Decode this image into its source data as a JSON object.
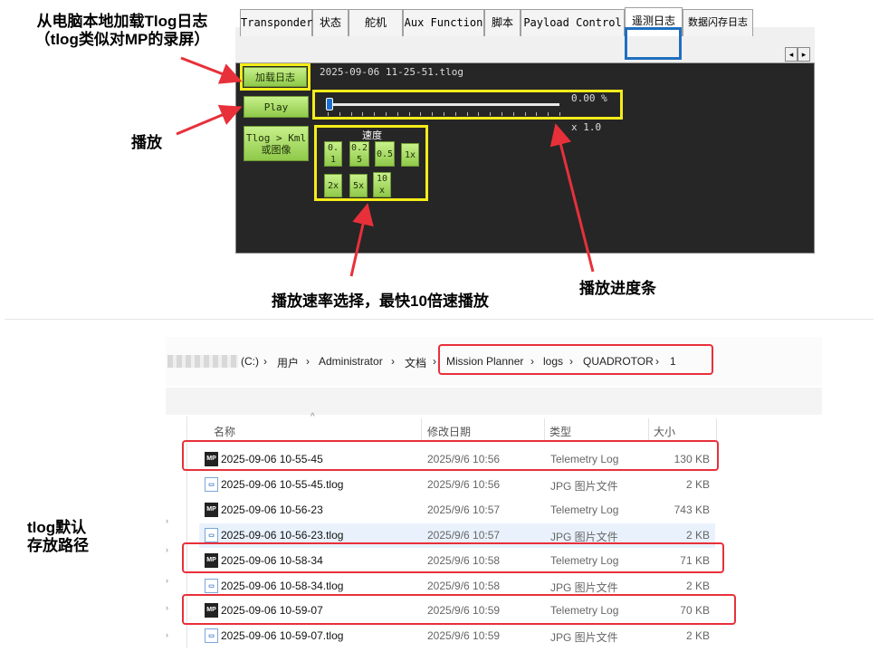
{
  "annotations": {
    "load_note_line1": "从电脑本地加载Tlog日志",
    "load_note_line2": "（tlog类似对MP的录屏）",
    "play_note": "播放",
    "speed_note": "播放速率选择，最快10倍速播放",
    "progress_note": "播放进度条",
    "path_note_line1": "tlog默认",
    "path_note_line2": "存放路径"
  },
  "tabs": [
    "Transponder",
    "状态",
    "舵机",
    "Aux Function",
    "脚本",
    "Payload Control",
    "遥测日志",
    "数据闪存日志"
  ],
  "tab_nav": {
    "left": "◂",
    "right": "▸"
  },
  "telemetry_log": {
    "load_button": "加载日志",
    "play_button": "Play",
    "convert_button": "Tlog > Kml 或图像",
    "filename": "2025-09-06 11-25-51.tlog",
    "progress_text": "0.00 %",
    "progress": 0.0,
    "speed_current": "x 1.0",
    "speed_label": "速度",
    "speed_buttons": [
      "0.1",
      "0.25",
      "0.5",
      "1x",
      "2x",
      "5x",
      "10x"
    ]
  },
  "breadcrumb": [
    "(C:)",
    "用户",
    "Administrator",
    "文档",
    "Mission Planner",
    "logs",
    "QUADROTOR",
    "1"
  ],
  "columns": {
    "name": "名称",
    "date": "修改日期",
    "type": "类型",
    "size": "大小"
  },
  "files": [
    {
      "name": "2025-09-06 10-55-45",
      "date": "2025/9/6 10:56",
      "type": "Telemetry Log",
      "size": "130 KB",
      "icon": "mp"
    },
    {
      "name": "2025-09-06 10-55-45.tlog",
      "date": "2025/9/6 10:56",
      "type": "JPG 图片文件",
      "size": "2 KB",
      "icon": "jpg"
    },
    {
      "name": "2025-09-06 10-56-23",
      "date": "2025/9/6 10:57",
      "type": "Telemetry Log",
      "size": "743 KB",
      "icon": "mp"
    },
    {
      "name": "2025-09-06 10-56-23.tlog",
      "date": "2025/9/6 10:57",
      "type": "JPG 图片文件",
      "size": "2 KB",
      "icon": "jpg"
    },
    {
      "name": "2025-09-06 10-58-34",
      "date": "2025/9/6 10:58",
      "type": "Telemetry Log",
      "size": "71 KB",
      "icon": "mp"
    },
    {
      "name": "2025-09-06 10-58-34.tlog",
      "date": "2025/9/6 10:58",
      "type": "JPG 图片文件",
      "size": "2 KB",
      "icon": "jpg"
    },
    {
      "name": "2025-09-06 10-59-07",
      "date": "2025/9/6 10:59",
      "type": "Telemetry Log",
      "size": "70 KB",
      "icon": "mp"
    },
    {
      "name": "2025-09-06 10-59-07.tlog",
      "date": "2025/9/6 10:59",
      "type": "JPG 图片文件",
      "size": "2 KB",
      "icon": "jpg"
    }
  ],
  "colors": {
    "highlight_yellow": "#f4ec1a",
    "annotation_red": "#e8303a",
    "tab_highlight_blue": "#1f6fc0",
    "button_green": "#a8dd6a"
  }
}
